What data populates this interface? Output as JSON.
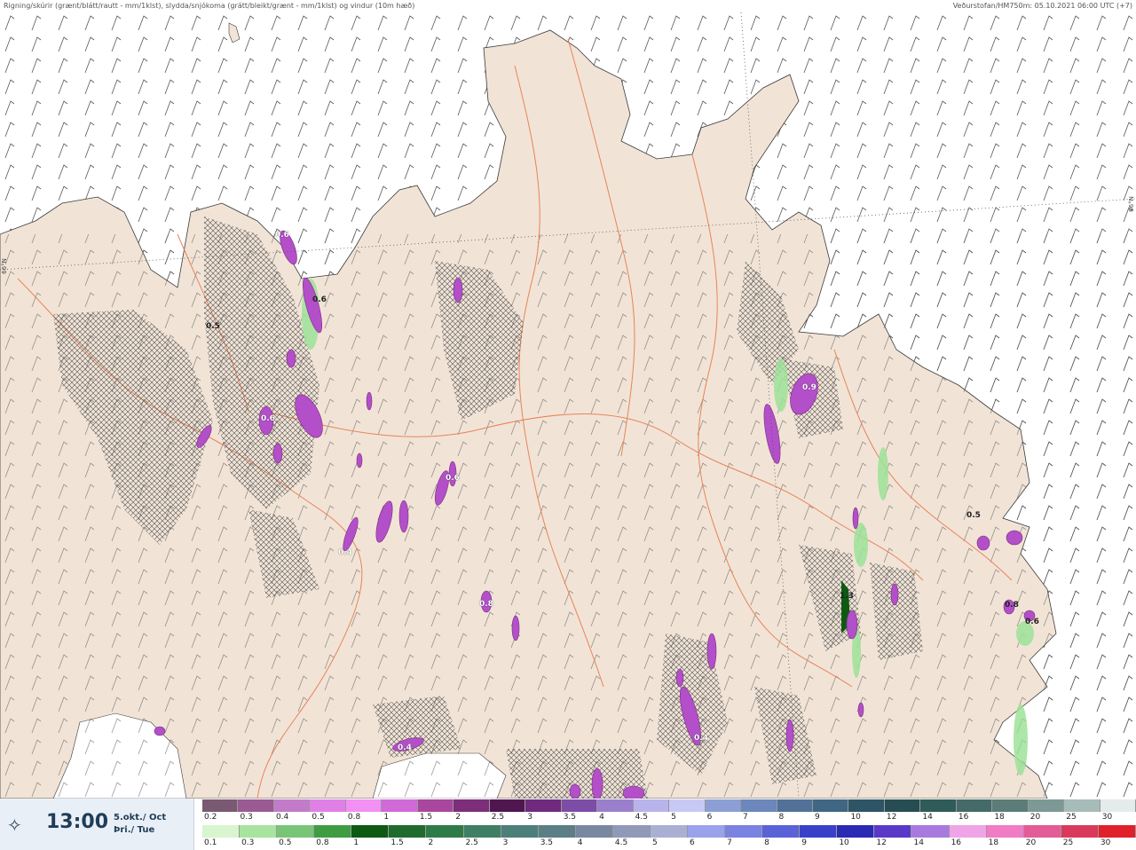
{
  "header": {
    "title": "Rigning/skúrir (grænt/blátt/rautt - mm/1klst), slydda/snjókoma (grátt/bleikt/grænt - mm/1klst) og vindur (10m hæð)",
    "source": "Veðurstofan/HM750m: 05.10.2021 06:00 UTC (+7)"
  },
  "map": {
    "colors": {
      "sea": "#ffffff",
      "land": "#f1e4d6",
      "coast": "#3a3a3a",
      "roads": "#e8835c",
      "wind_barbs": "#555555",
      "precip_snow": "#b24fc9",
      "precip_rain": "#9ee29a"
    },
    "lat_labels": [
      "66°N",
      "66°N"
    ],
    "value_labels": [
      {
        "text": "0.5",
        "style": "dark"
      },
      {
        "text": "0.6",
        "style": "light"
      },
      {
        "text": "0.6",
        "style": "dark"
      },
      {
        "text": "0.9",
        "style": "light"
      },
      {
        "text": "0.6",
        "style": "light"
      },
      {
        "text": "0.4",
        "style": "light"
      },
      {
        "text": "0.8",
        "style": "light"
      },
      {
        "text": "0.5",
        "style": "dark"
      },
      {
        "text": "0.8",
        "style": "dark"
      },
      {
        "text": "0.6",
        "style": "dark"
      },
      {
        "text": "1.3",
        "style": "dark"
      },
      {
        "text": "0.4",
        "style": "light"
      },
      {
        "text": "0.4",
        "style": "light"
      },
      {
        "text": "0.6",
        "style": "light"
      }
    ]
  },
  "footer": {
    "compass_icon": "compass-icon",
    "time": "13:00",
    "date_line1": "5.okt./ Oct",
    "date_line2": "Þri./ Tue"
  },
  "scale_top": {
    "labels": [
      "0.2",
      "0.3",
      "0.4",
      "0.5",
      "0.8",
      "1",
      "1.5",
      "2",
      "2.5",
      "3",
      "3.5",
      "4",
      "4.5",
      "5",
      "6",
      "7",
      "8",
      "9",
      "10",
      "12",
      "14",
      "16",
      "18",
      "20",
      "25",
      "30"
    ],
    "colors": [
      "#7a5a73",
      "#9a5a94",
      "#c27bc8",
      "#e07fe6",
      "#f290f4",
      "#d06ad8",
      "#a9479f",
      "#7c2e7a",
      "#4f1650",
      "#6f2a7e",
      "#7c4da6",
      "#9a80cc",
      "#b8b3ea",
      "#c7c9f4",
      "#8c9fd4",
      "#6b87bb",
      "#527198",
      "#3f6682",
      "#2e5565",
      "#264d52",
      "#2f5b58",
      "#446b68",
      "#5c7c78",
      "#7d9995",
      "#a7bcb8",
      "#e3ecea"
    ]
  },
  "scale_bottom": {
    "labels": [
      "0.1",
      "0.3",
      "0.5",
      "0.8",
      "1",
      "1.5",
      "2",
      "2.5",
      "3",
      "3.5",
      "4",
      "4.5",
      "5",
      "6",
      "7",
      "8",
      "9",
      "10",
      "12",
      "14",
      "16",
      "18",
      "20",
      "25",
      "30"
    ],
    "colors": [
      "#d8f5d0",
      "#a8e3a0",
      "#79c577",
      "#3f9c42",
      "#0e5a12",
      "#1f6b2e",
      "#2f7b47",
      "#3f7f63",
      "#4d7f7a",
      "#5c7f86",
      "#78889e",
      "#9099b8",
      "#aab0d4",
      "#9aa2ec",
      "#7a82e2",
      "#5a62d8",
      "#3b40c8",
      "#2a2ab4",
      "#5a39c8",
      "#a87ae0",
      "#f0a4e8",
      "#f27bc6",
      "#e35c98",
      "#d93a5c",
      "#e0202a"
    ]
  }
}
